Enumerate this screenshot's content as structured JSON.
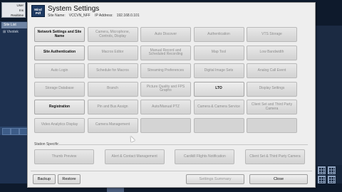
{
  "background_app": {
    "login_lines": [
      "User",
      "Ins",
      "Realtime",
      "Vi"
    ],
    "site_list_label": "Site List",
    "tree_item": "Vivotek"
  },
  "dialog": {
    "logo_text": "Mind Pdf",
    "title": "System Settings",
    "site_name_label": "Site Name:",
    "site_name": "VCCVN_NFF",
    "ip_label": "IP Address:",
    "ip": "192.168.0.101"
  },
  "settings_buttons": [
    {
      "label": "Network Settings and Site Name",
      "active": true
    },
    {
      "label": "Camera, Microphone, Controls, Display",
      "active": false
    },
    {
      "label": "Auto Discover",
      "active": false
    },
    {
      "label": "Authentication",
      "active": false
    },
    {
      "label": "VTS Storage",
      "active": false
    },
    {
      "label": "Site Authentication",
      "active": true
    },
    {
      "label": "Macros Editor",
      "active": false
    },
    {
      "label": "Manual Record and Scheduled Recording",
      "active": false
    },
    {
      "label": "Map Tool",
      "active": false
    },
    {
      "label": "Low Bandwidth",
      "active": false
    },
    {
      "label": "Auto Login",
      "active": false
    },
    {
      "label": "Schedule for Macros",
      "active": false
    },
    {
      "label": "Streaming Preferences",
      "active": false
    },
    {
      "label": "Digital Image Sets",
      "active": false
    },
    {
      "label": "Analog Call Event",
      "active": false
    },
    {
      "label": "Storage Database",
      "active": false
    },
    {
      "label": "Branch",
      "active": false
    },
    {
      "label": "Picture Quality and FPS Graphs",
      "active": false
    },
    {
      "label": "LTO",
      "active": true
    },
    {
      "label": "Display Settings",
      "active": false
    },
    {
      "label": "Registration",
      "active": true
    },
    {
      "label": "Pin and Bus Assign",
      "active": false
    },
    {
      "label": "Auto/Manual PTZ",
      "active": false
    },
    {
      "label": "Camera & Camera Service",
      "active": false
    },
    {
      "label": "Client Set and Third Party Camera",
      "active": false
    },
    {
      "label": "Video Analytics Display",
      "active": false
    },
    {
      "label": "Camera Management",
      "active": false
    },
    {
      "label": "",
      "active": false
    },
    {
      "label": "",
      "active": false
    },
    {
      "label": "",
      "active": false
    }
  ],
  "section": {
    "label": "Station Specific",
    "buttons": [
      "Thumb Preview",
      "Alert & Contact Management",
      "Cardkill Flights Notification",
      "Client Set & Third Party Camera"
    ]
  },
  "footer": {
    "backup": "Backup",
    "restore": "Restore",
    "settings_summary": "Settings Summary",
    "close": "Close"
  }
}
